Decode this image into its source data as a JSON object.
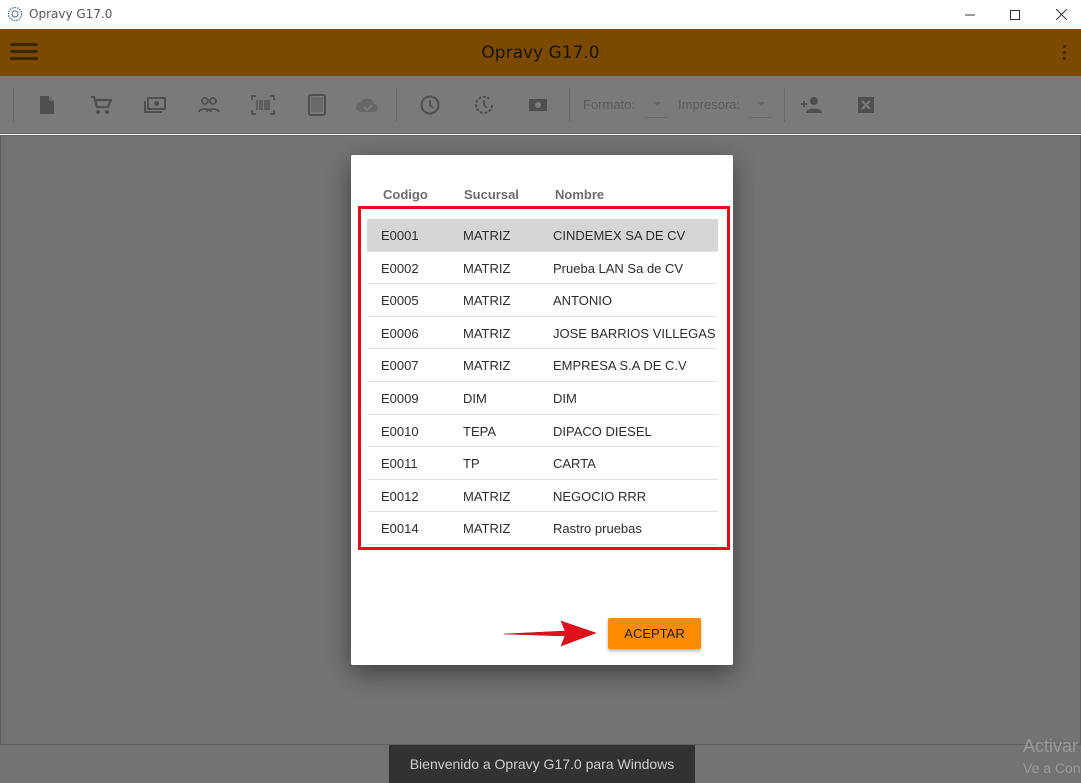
{
  "window": {
    "title": "Opravy G17.0"
  },
  "appbar": {
    "title": "Opravy G17.0",
    "accent": "#7a4a00"
  },
  "toolbar": {
    "icons": [
      "document-icon",
      "cart-icon",
      "cash-icon",
      "people-icon",
      "barcode-icon",
      "tablet-icon",
      "cloud-icon",
      "clock-icon",
      "history-icon",
      "money-icon",
      "person-add-icon",
      "close-box-icon"
    ],
    "format_label": "Formato:",
    "printer_label": "Impresora:"
  },
  "dialog": {
    "columns": [
      "Codigo",
      "Sucursal",
      "Nombre"
    ],
    "rows": [
      {
        "codigo": "E0001",
        "sucursal": "MATRIZ",
        "nombre": "CINDEMEX SA DE CV"
      },
      {
        "codigo": "E0002",
        "sucursal": "MATRIZ",
        "nombre": "Prueba LAN Sa de CV"
      },
      {
        "codigo": "E0005",
        "sucursal": "MATRIZ",
        "nombre": "ANTONIO"
      },
      {
        "codigo": "E0006",
        "sucursal": "MATRIZ",
        "nombre": "JOSE BARRIOS VILLEGAS"
      },
      {
        "codigo": "E0007",
        "sucursal": "MATRIZ",
        "nombre": "EMPRESA S.A DE C.V"
      },
      {
        "codigo": "E0009",
        "sucursal": "DIM",
        "nombre": "DIM"
      },
      {
        "codigo": "E0010",
        "sucursal": "TEPA",
        "nombre": "DIPACO DIESEL"
      },
      {
        "codigo": "E0011",
        "sucursal": "TP",
        "nombre": "CARTA"
      },
      {
        "codigo": "E0012",
        "sucursal": "MATRIZ",
        "nombre": "NEGOCIO RRR"
      },
      {
        "codigo": "E0014",
        "sucursal": "MATRIZ",
        "nombre": "Rastro pruebas"
      }
    ],
    "accept_label": "ACEPTAR",
    "highlight_color": "#e0111b",
    "button_color": "#ff8c00"
  },
  "snackbar": {
    "message": "Bienvenido a Opravy G17.0 para Windows"
  },
  "watermark": {
    "line1": "Activar",
    "line2": "Ve a Con"
  }
}
